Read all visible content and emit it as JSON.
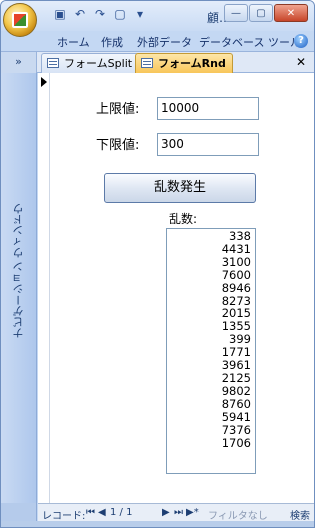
{
  "titlebar": {
    "title": "顧…",
    "qat": [
      "save-icon",
      "undo-icon",
      "redo-icon",
      "new-icon",
      "dropdown-icon"
    ]
  },
  "ribbon": {
    "tabs": [
      "ホーム",
      "作成",
      "外部データ",
      "データベース ツール"
    ]
  },
  "document_tabs": [
    {
      "label": "フォームSplit",
      "active": false
    },
    {
      "label": "フォームRnd",
      "active": true
    }
  ],
  "nav_pane": {
    "toggle": "»",
    "label": "ナビゲーション ウィンドウ"
  },
  "form": {
    "upper_label": "上限値:",
    "upper_value": "10000",
    "lower_label": "下限値:",
    "lower_value": "300",
    "generate_button": "乱数発生",
    "list_label": "乱数:",
    "random_numbers": [
      "338",
      "4431",
      "3100",
      "7600",
      "8946",
      "8273",
      "2015",
      "1355",
      "399",
      "1771",
      "3961",
      "2125",
      "9802",
      "8760",
      "5941",
      "7376",
      "1706"
    ]
  },
  "record_nav": {
    "label": "レコード:",
    "position": "1 / 1",
    "filter": "フィルタなし",
    "search": "検索"
  }
}
